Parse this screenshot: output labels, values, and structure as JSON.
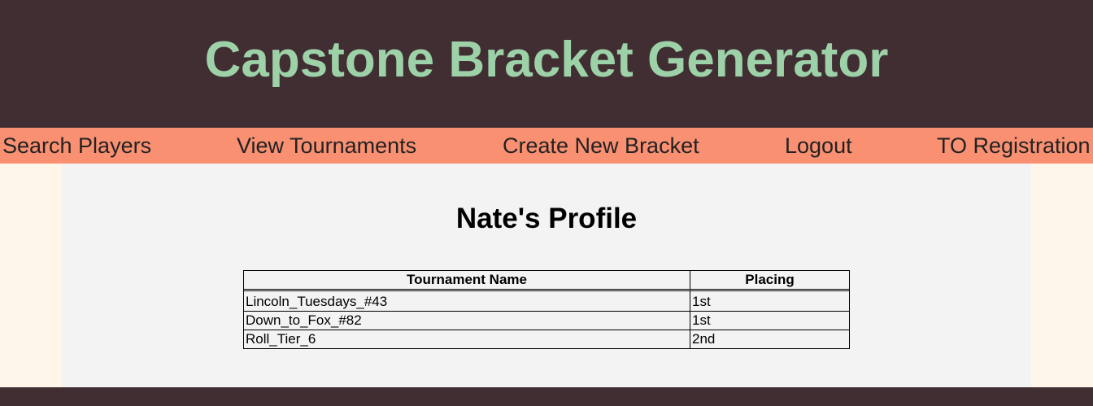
{
  "header": {
    "title": "Capstone Bracket Generator"
  },
  "nav": {
    "items": [
      {
        "label": "Search Players"
      },
      {
        "label": "View Tournaments"
      },
      {
        "label": "Create New Bracket"
      },
      {
        "label": "Logout"
      },
      {
        "label": "TO Registration"
      }
    ]
  },
  "profile": {
    "title": "Nate's Profile",
    "table": {
      "headers": [
        "Tournament Name",
        "Placing"
      ],
      "rows": [
        [
          "Lincoln_Tuesdays_#43",
          "1st"
        ],
        [
          "Down_to_Fox_#82",
          "1st"
        ],
        [
          "Roll_Tier_6",
          "2nd"
        ]
      ]
    }
  },
  "colors": {
    "header_bg": "#412e33",
    "title_color": "#9dd2a9",
    "nav_bg": "#f99072",
    "page_bg": "#fff6ea",
    "content_bg": "#f3f3f3"
  }
}
